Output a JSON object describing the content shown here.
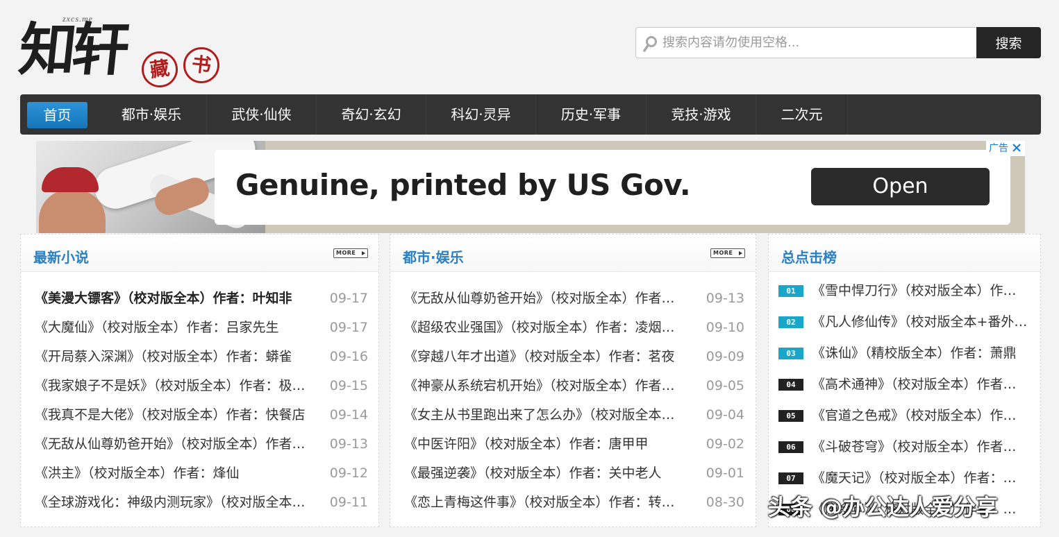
{
  "logo": {
    "site": "zxcs.me",
    "main": "知轩",
    "seal1": "藏",
    "seal2": "书"
  },
  "search": {
    "placeholder": "搜索内容请勿使用空格...",
    "button": "搜索"
  },
  "nav": [
    "首页",
    "都市·娱乐",
    "武侠·仙侠",
    "奇幻·玄幻",
    "科幻·灵异",
    "历史·军事",
    "竞技·游戏",
    "二次元"
  ],
  "ad": {
    "headline": "Genuine, printed by US Gov.",
    "cta": "Open",
    "flag": "广告"
  },
  "latest": {
    "title": "最新小说",
    "more": "MORE",
    "items": [
      {
        "t": "《美漫大镖客》（校对版全本）作者：叶知非",
        "d": "09-17"
      },
      {
        "t": "《大魔仙》（校对版全本）作者：吕家先生",
        "d": "09-17"
      },
      {
        "t": "《开局蔡入深渊》（校对版全本）作者：蟒雀",
        "d": "09-16"
      },
      {
        "t": "《我家娘子不是妖》（校对版全本）作者：极…",
        "d": "09-15"
      },
      {
        "t": "《我真不是大佬》（校对版全本）作者：快餐店",
        "d": "09-14"
      },
      {
        "t": "《无敌从仙尊奶爸开始》（校对版全本）作者…",
        "d": "09-13"
      },
      {
        "t": "《洪主》（校对版全本）作者：烽仙",
        "d": "09-12"
      },
      {
        "t": "《全球游戏化：神级内测玩家》（校对版全本…",
        "d": "09-11"
      }
    ]
  },
  "urban": {
    "title": "都市·娱乐",
    "more": "MORE",
    "items": [
      {
        "t": "《无敌从仙尊奶爸开始》（校对版全本）作者…",
        "d": "09-13"
      },
      {
        "t": "《超级农业强国》（校对版全本）作者：凌烟…",
        "d": "09-10"
      },
      {
        "t": "《穿越八年才出道》（校对版全本）作者：茗夜",
        "d": "09-09"
      },
      {
        "t": "《神豪从系统宕机开始》（校对版全本）作者…",
        "d": "09-05"
      },
      {
        "t": "《女主从书里跑出来了怎么办》（校对版全本…",
        "d": "09-04"
      },
      {
        "t": "《中医许阳》（校对版全本）作者：唐甲甲",
        "d": "09-02"
      },
      {
        "t": "《最强逆袭》（校对版全本）作者：关中老人",
        "d": "09-01"
      },
      {
        "t": "《恋上青梅这件事》（校对版全本）作者：转…",
        "d": "08-30"
      }
    ]
  },
  "rank": {
    "title": "总点击榜",
    "items": [
      {
        "n": "01",
        "t": "《雪中悍刀行》（校对版全本）作…"
      },
      {
        "n": "02",
        "t": "《凡人修仙传》（校对版全本+番外…"
      },
      {
        "n": "03",
        "t": "《诛仙》（精校版全本）作者：萧鼎"
      },
      {
        "n": "04",
        "t": "《高术通神》（校对版全本）作者…"
      },
      {
        "n": "05",
        "t": "《官道之色戒》（校对版全本）作…"
      },
      {
        "n": "06",
        "t": "《斗破苍穹》（校对版全本）作者…"
      },
      {
        "n": "07",
        "t": "《魔天记》（校对版全本）作者：…"
      },
      {
        "n": "08",
        "t": "《庆余年》（校对版全本）作者：…"
      }
    ]
  },
  "watermark": "头条 @办公达人爱分享"
}
